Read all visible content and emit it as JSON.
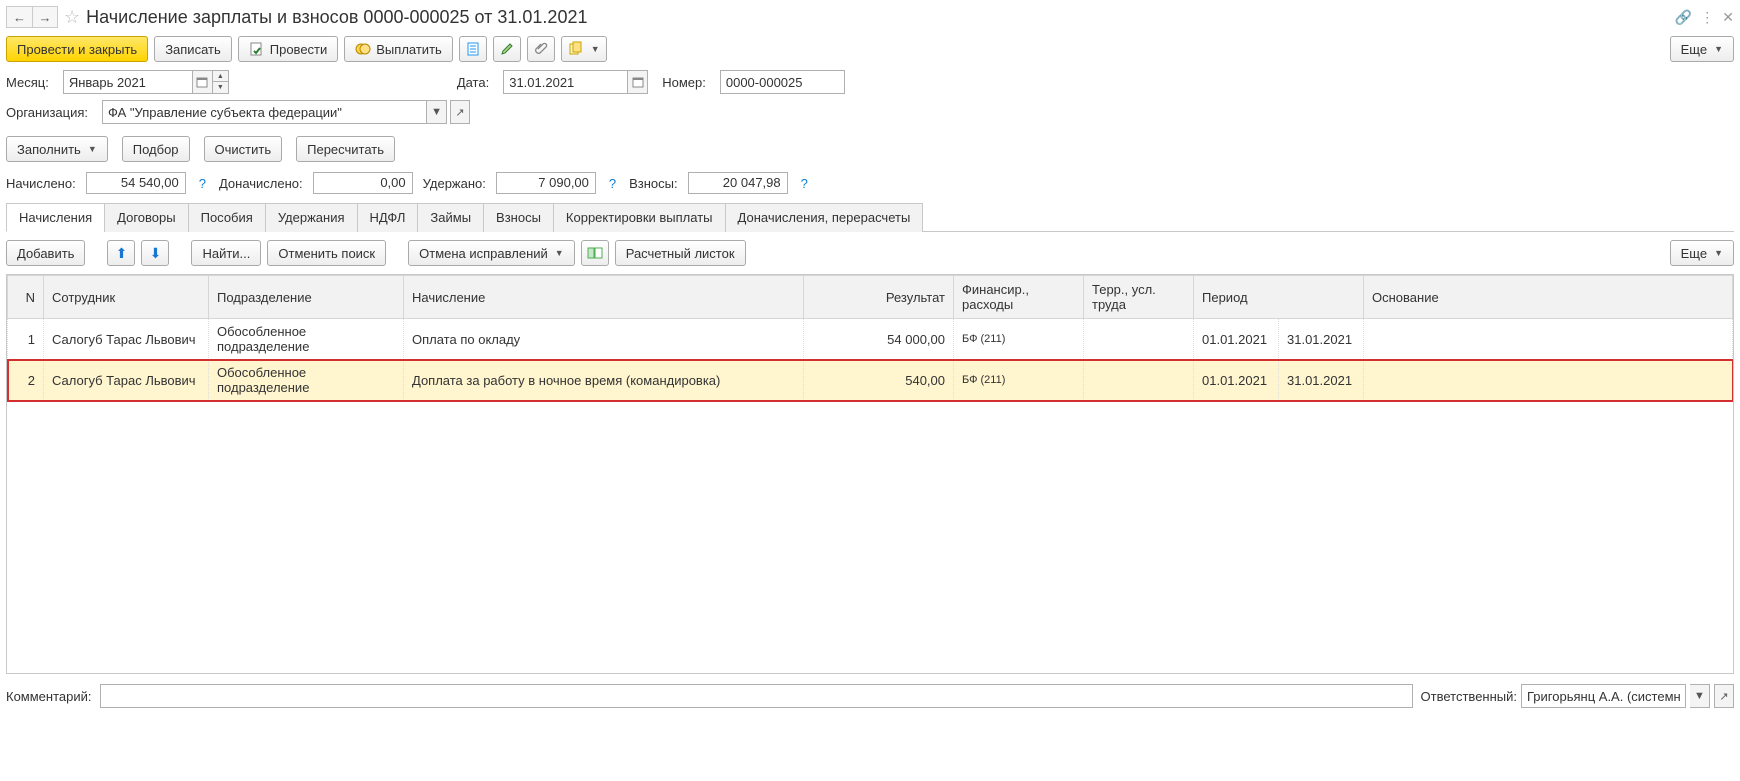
{
  "title": "Начисление зарплаты и взносов 0000-000025 от 31.01.2021",
  "toolbar": {
    "post_close": "Провести и закрыть",
    "save": "Записать",
    "post": "Провести",
    "pay": "Выплатить",
    "more": "Еще"
  },
  "form": {
    "month_label": "Месяц:",
    "month_value": "Январь 2021",
    "date_label": "Дата:",
    "date_value": "31.01.2021",
    "number_label": "Номер:",
    "number_value": "0000-000025",
    "org_label": "Организация:",
    "org_value": "ФА \"Управление субъекта федерации\""
  },
  "actions": {
    "fill": "Заполнить",
    "pick": "Подбор",
    "clear": "Очистить",
    "recalc": "Пересчитать"
  },
  "totals": {
    "accrued_label": "Начислено:",
    "accrued_value": "54 540,00",
    "additional_label": "Доначислено:",
    "additional_value": "0,00",
    "withheld_label": "Удержано:",
    "withheld_value": "7 090,00",
    "contrib_label": "Взносы:",
    "contrib_value": "20 047,98"
  },
  "tabs": [
    {
      "label": "Начисления",
      "active": true
    },
    {
      "label": "Договоры"
    },
    {
      "label": "Пособия"
    },
    {
      "label": "Удержания"
    },
    {
      "label": "НДФЛ"
    },
    {
      "label": "Займы"
    },
    {
      "label": "Взносы"
    },
    {
      "label": "Корректировки выплаты"
    },
    {
      "label": "Доначисления, перерасчеты"
    }
  ],
  "tab_toolbar": {
    "add": "Добавить",
    "find": "Найти...",
    "cancel_find": "Отменить поиск",
    "cancel_fix": "Отмена исправлений",
    "payslip": "Расчетный листок",
    "more": "Еще"
  },
  "columns": {
    "n": "N",
    "employee": "Сотрудник",
    "dept": "Подразделение",
    "accrual": "Начисление",
    "result": "Результат",
    "finance": "Финансир., расходы",
    "terr": "Терр., усл. труда",
    "period": "Период",
    "basis": "Основание"
  },
  "rows": [
    {
      "n": "1",
      "employee": "Салогуб Тарас Львович",
      "dept": "Обособленное подразделение",
      "accrual": "Оплата по окладу",
      "result": "54 000,00",
      "finance": "БФ (211)",
      "terr": "",
      "p1": "01.01.2021",
      "p2": "31.01.2021",
      "basis": ""
    },
    {
      "n": "2",
      "employee": "Салогуб Тарас Львович",
      "dept": "Обособленное подразделение",
      "accrual": "Доплата за работу в ночное время (командировка)",
      "result": "540,00",
      "finance": "БФ (211)",
      "terr": "",
      "p1": "01.01.2021",
      "p2": "31.01.2021",
      "basis": "",
      "hl": true
    }
  ],
  "footer": {
    "comment_label": "Комментарий:",
    "comment_value": "",
    "resp_label": "Ответственный:",
    "resp_value": "Григорьянц А.А. (системн"
  }
}
